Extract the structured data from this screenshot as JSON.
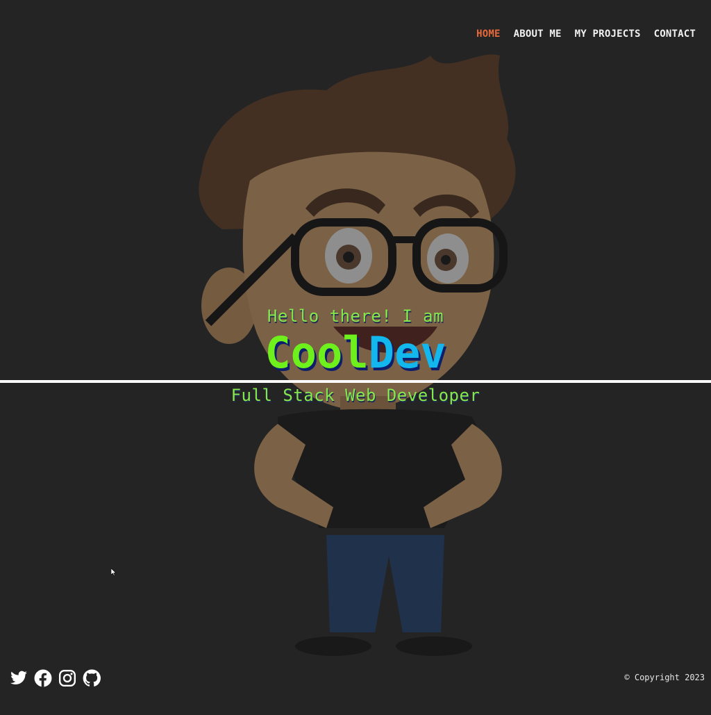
{
  "nav": {
    "items": [
      {
        "label": "HOME",
        "active": true
      },
      {
        "label": "ABOUT ME",
        "active": false
      },
      {
        "label": "MY PROJECTS",
        "active": false
      },
      {
        "label": "CONTACT",
        "active": false
      }
    ]
  },
  "hero": {
    "greeting": "Hello there! I am",
    "brand_part1": "Cool",
    "brand_part2": "Dev",
    "role": "Full Stack Web Developer"
  },
  "footer": {
    "socials": [
      {
        "icon": "twitter-icon"
      },
      {
        "icon": "facebook-icon"
      },
      {
        "icon": "instagram-icon"
      },
      {
        "icon": "github-icon"
      }
    ],
    "copyright": "© Copyright 2023"
  },
  "colors": {
    "background": "#242424",
    "nav_active": "#e8693a",
    "text_green": "#86e84a",
    "brand_green": "#6ef01c",
    "brand_blue": "#12b7ee"
  }
}
